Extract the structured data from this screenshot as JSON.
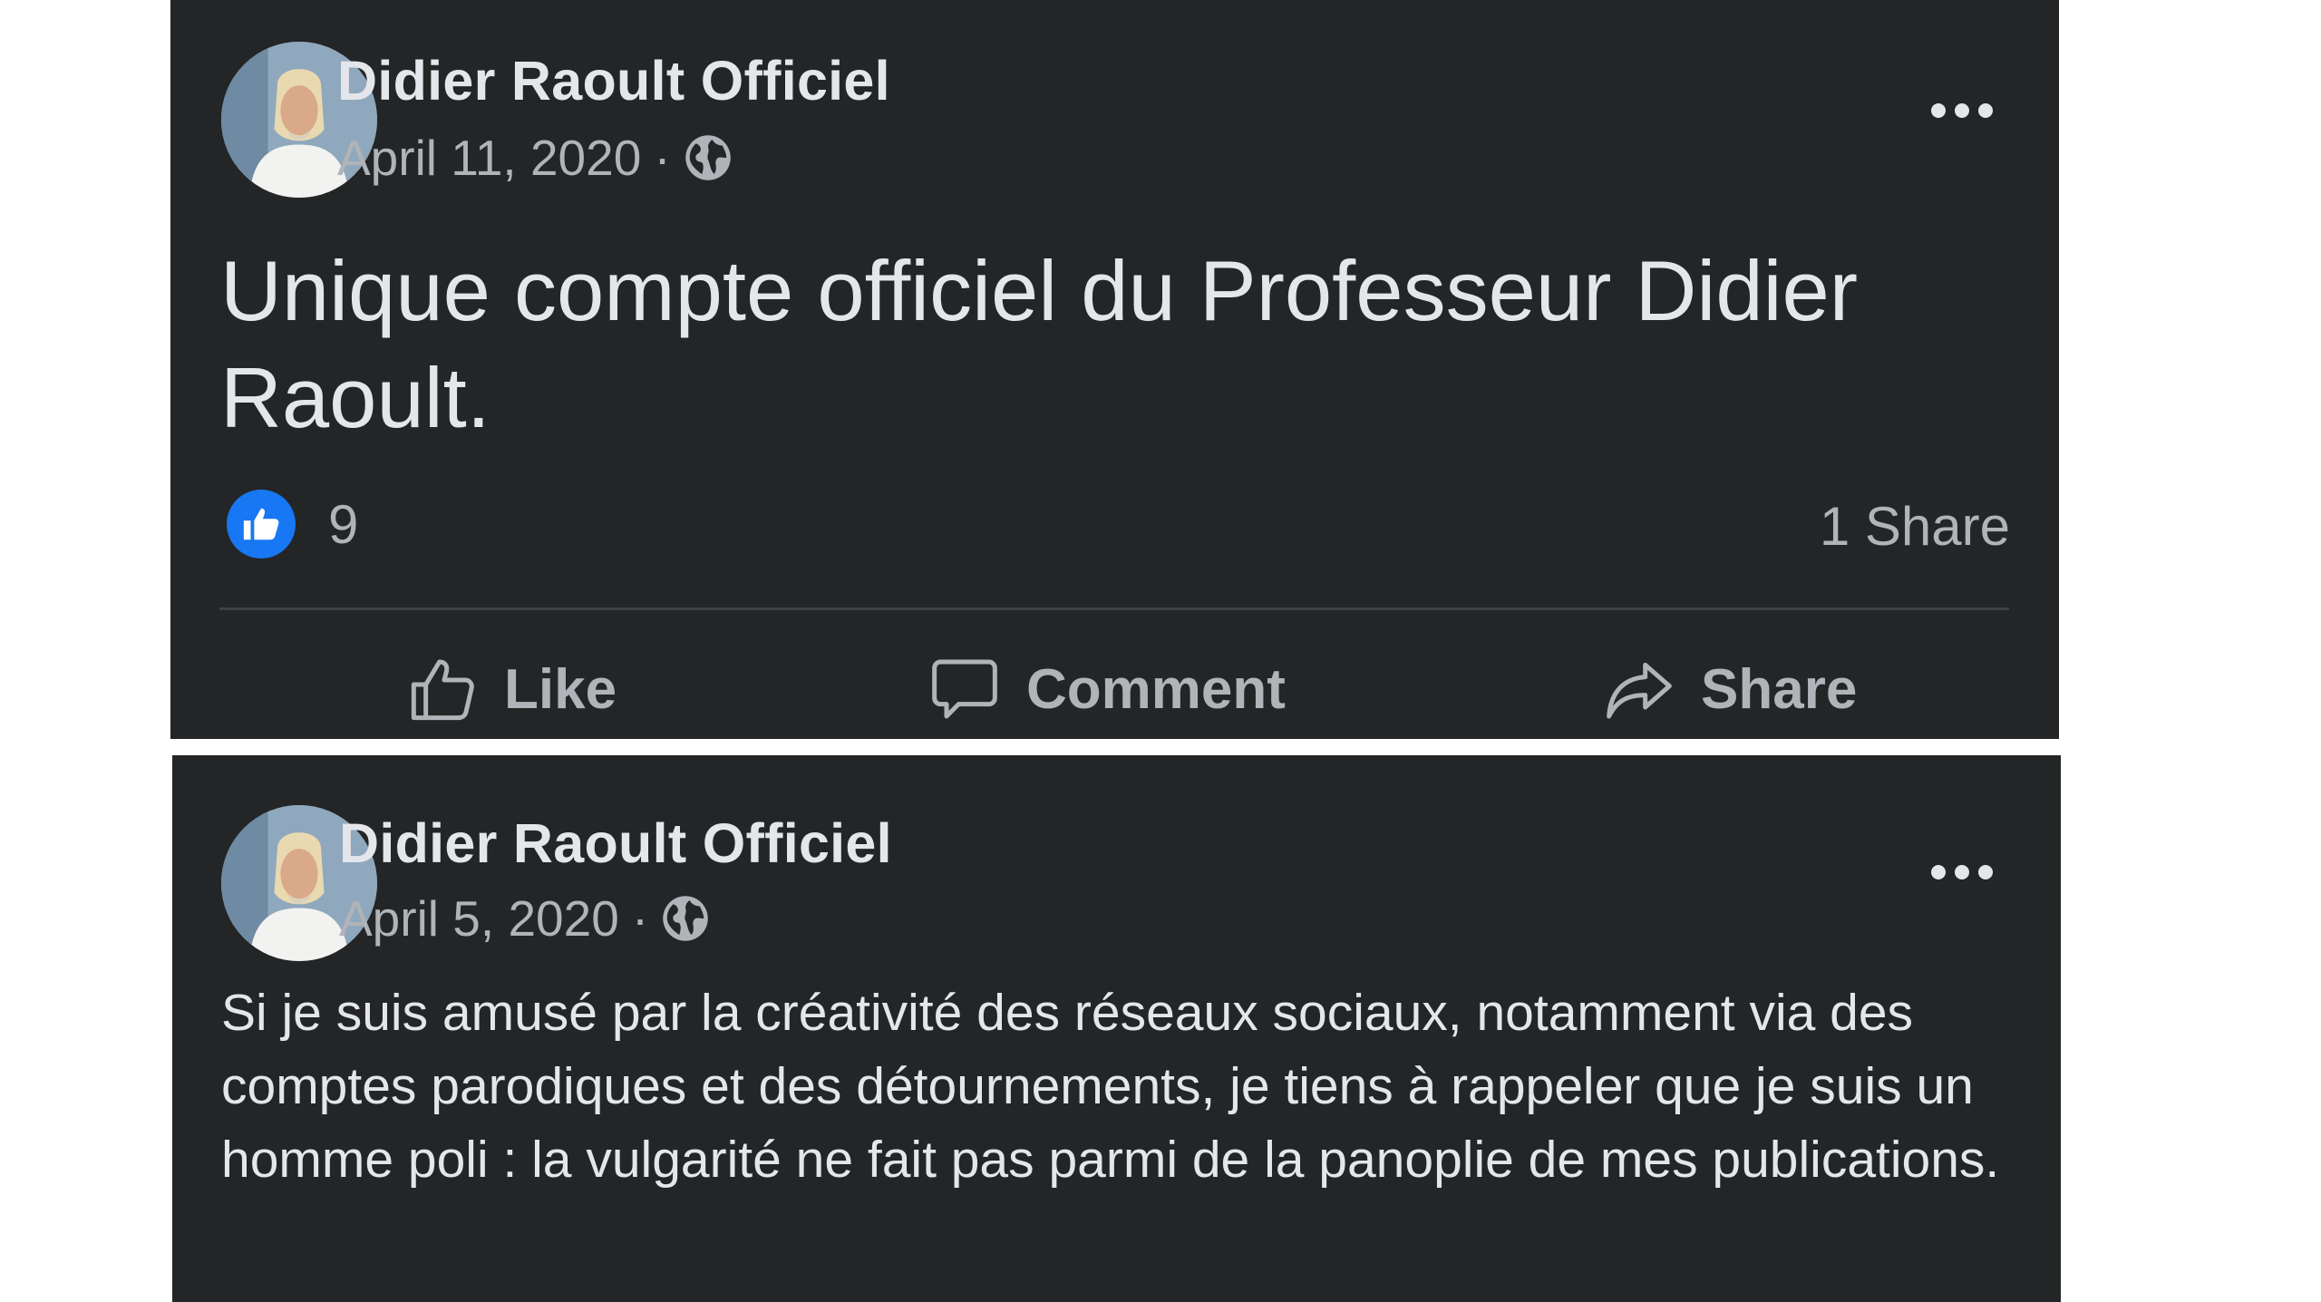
{
  "posts": [
    {
      "author": "Didier Raoult Officiel",
      "date": "April 11, 2020",
      "separator": "·",
      "audience_icon": "globe-icon",
      "text": "Unique compte officiel du Professeur Didier Raoult.",
      "reactions": {
        "icon": "like-reaction-icon",
        "count": "9"
      },
      "shares": "1 Share",
      "actions": {
        "like": "Like",
        "comment": "Comment",
        "share": "Share"
      }
    },
    {
      "author": "Didier Raoult Officiel",
      "date": "April 5, 2020",
      "separator": "·",
      "audience_icon": "globe-icon",
      "text": "Si je suis amusé par la créativité des réseaux sociaux, notamment via des comptes parodiques et des détournements, je tiens à rappeler que je suis un homme poli : la vulgarité ne fait pas parmi de la panoplie de mes publications."
    }
  ],
  "colors": {
    "card_bg": "#242526",
    "text_primary": "#e4e6eb",
    "text_secondary": "#b0b3b8",
    "like_blue": "#1877f2"
  }
}
